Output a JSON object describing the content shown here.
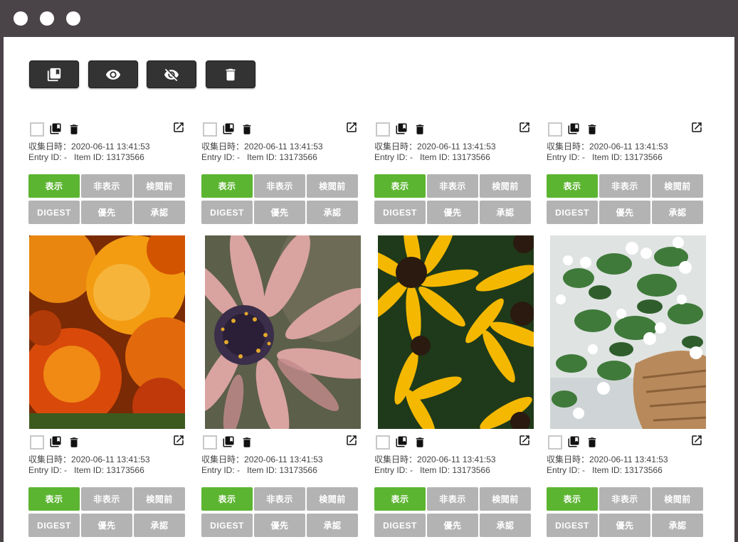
{
  "toolbar": {
    "buttons": [
      {
        "icon": "copy-icon"
      },
      {
        "icon": "eye-icon"
      },
      {
        "icon": "eye-off-icon"
      },
      {
        "icon": "trash-icon"
      }
    ]
  },
  "colors": {
    "accent_green": "#5cb531",
    "button_gray": "#b3b3b3",
    "toolbar_dark": "#333333",
    "chrome": "#4a4348"
  },
  "labels": {
    "collected_prefix": "収集日時：",
    "entry_prefix": "Entry ID: ",
    "item_prefix": "Item ID: ",
    "btn_show": "表示",
    "btn_hide": "非表示",
    "btn_review": "検閲前",
    "btn_digest": "DIGEST",
    "btn_priority": "優先",
    "btn_approve": "承認"
  },
  "cards": [
    {
      "collected": "2020-06-11 13:41:53",
      "entry_id": "-",
      "item_id": "13173566",
      "photo": "marigold"
    },
    {
      "collected": "2020-06-11 13:41:53",
      "entry_id": "-",
      "item_id": "13173566",
      "photo": "pink-daisy"
    },
    {
      "collected": "2020-06-11 13:41:53",
      "entry_id": "-",
      "item_id": "13173566",
      "photo": "black-eyed-susan"
    },
    {
      "collected": "2020-06-11 13:41:53",
      "entry_id": "-",
      "item_id": "13173566",
      "photo": "white-flowers-basket"
    },
    {
      "collected": "2020-06-11 13:41:53",
      "entry_id": "-",
      "item_id": "13173566"
    },
    {
      "collected": "2020-06-11 13:41:53",
      "entry_id": "-",
      "item_id": "13173566"
    },
    {
      "collected": "2020-06-11 13:41:53",
      "entry_id": "-",
      "item_id": "13173566"
    },
    {
      "collected": "2020-06-11 13:41:53",
      "entry_id": "-",
      "item_id": "13173566"
    }
  ]
}
